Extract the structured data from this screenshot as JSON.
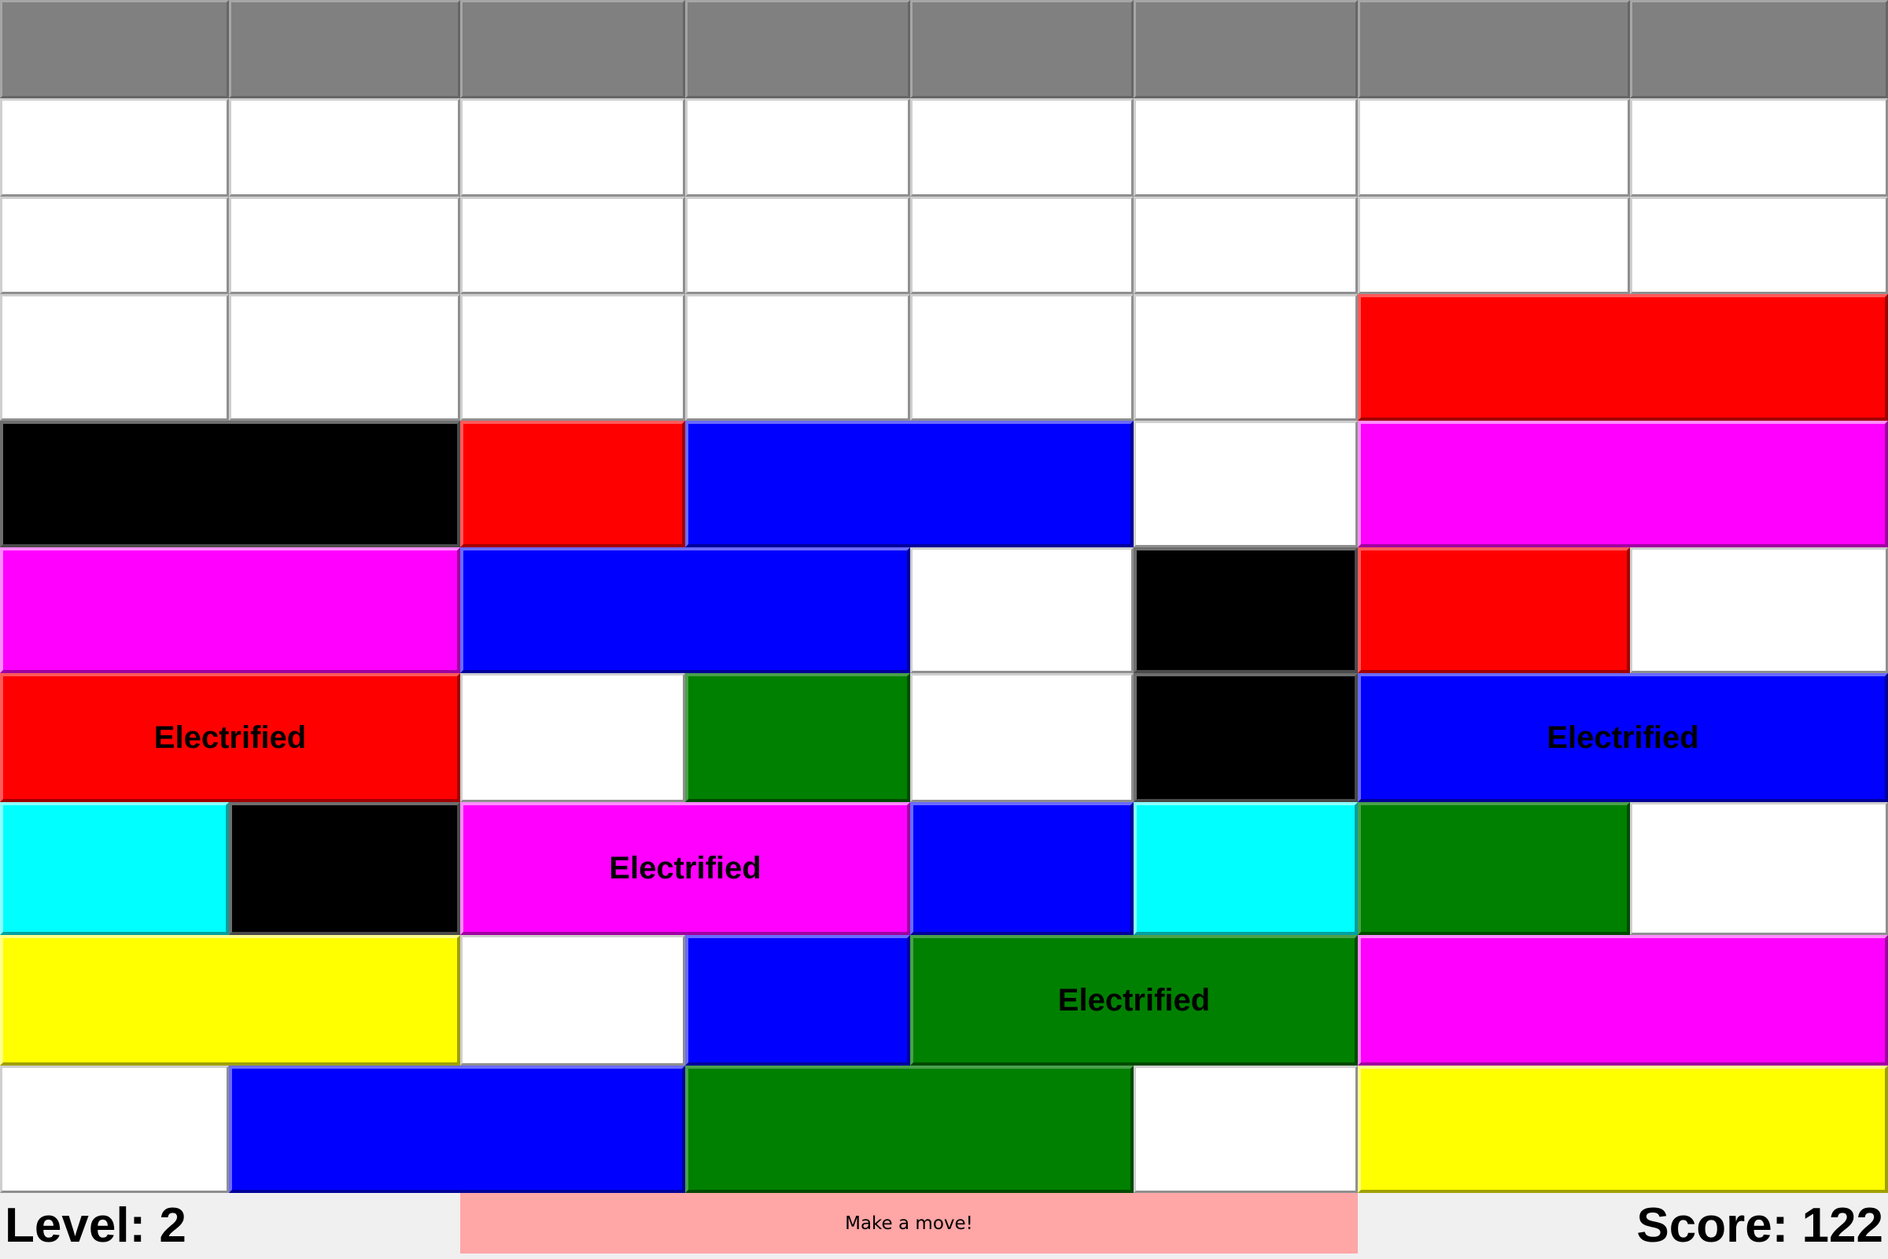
{
  "status": {
    "level": "Level: 2",
    "message": "Make a move!",
    "score": "Score: 122"
  },
  "colors": {
    "red": "#ff0000",
    "blue": "#0000ff",
    "black": "#000000",
    "magenta": "#ff00ff",
    "green": "#008000",
    "cyan": "#00ffff",
    "yellow": "#ffff00",
    "empty": "#ffffff",
    "header": "#808080",
    "message_bg": "#ffa6a6"
  },
  "board": {
    "columns": 8,
    "rows": [
      [
        {
          "type": "header",
          "span": 1
        },
        {
          "type": "header",
          "span": 1
        },
        {
          "type": "header",
          "span": 1
        },
        {
          "type": "header",
          "span": 1
        },
        {
          "type": "header",
          "span": 1
        },
        {
          "type": "header",
          "span": 1
        },
        {
          "type": "header",
          "span": 1
        },
        {
          "type": "header",
          "span": 1
        }
      ],
      [
        {
          "type": "empty",
          "span": 1
        },
        {
          "type": "empty",
          "span": 1
        },
        {
          "type": "empty",
          "span": 1
        },
        {
          "type": "empty",
          "span": 1
        },
        {
          "type": "empty",
          "span": 1
        },
        {
          "type": "empty",
          "span": 1
        },
        {
          "type": "empty",
          "span": 1
        },
        {
          "type": "empty",
          "span": 1
        }
      ],
      [
        {
          "type": "empty",
          "span": 1
        },
        {
          "type": "empty",
          "span": 1
        },
        {
          "type": "empty",
          "span": 1
        },
        {
          "type": "empty",
          "span": 1
        },
        {
          "type": "empty",
          "span": 1
        },
        {
          "type": "empty",
          "span": 1
        },
        {
          "type": "empty",
          "span": 1
        },
        {
          "type": "empty",
          "span": 1
        }
      ],
      [
        {
          "type": "empty",
          "span": 1
        },
        {
          "type": "empty",
          "span": 1
        },
        {
          "type": "empty",
          "span": 1
        },
        {
          "type": "empty",
          "span": 1
        },
        {
          "type": "empty",
          "span": 1
        },
        {
          "type": "empty",
          "span": 1
        },
        {
          "type": "block",
          "color": "red",
          "span": 2
        }
      ],
      [
        {
          "type": "block",
          "color": "black",
          "span": 2
        },
        {
          "type": "block",
          "color": "red",
          "span": 1
        },
        {
          "type": "block",
          "color": "blue",
          "span": 2
        },
        {
          "type": "empty",
          "span": 1
        },
        {
          "type": "block",
          "color": "magenta",
          "span": 2
        }
      ],
      [
        {
          "type": "block",
          "color": "magenta",
          "span": 2
        },
        {
          "type": "block",
          "color": "blue",
          "span": 2
        },
        {
          "type": "empty",
          "span": 1
        },
        {
          "type": "block",
          "color": "black",
          "span": 1
        },
        {
          "type": "block",
          "color": "red",
          "span": 1
        },
        {
          "type": "empty",
          "span": 1
        }
      ],
      [
        {
          "type": "block",
          "color": "red",
          "span": 2,
          "label": "Electrified"
        },
        {
          "type": "empty",
          "span": 1
        },
        {
          "type": "block",
          "color": "green",
          "span": 1
        },
        {
          "type": "empty",
          "span": 1
        },
        {
          "type": "block",
          "color": "black",
          "span": 1
        },
        {
          "type": "block",
          "color": "blue",
          "span": 2,
          "label": "Electrified"
        }
      ],
      [
        {
          "type": "block",
          "color": "cyan",
          "span": 1
        },
        {
          "type": "block",
          "color": "black",
          "span": 1
        },
        {
          "type": "block",
          "color": "magenta",
          "span": 2,
          "label": "Electrified"
        },
        {
          "type": "block",
          "color": "blue",
          "span": 1
        },
        {
          "type": "block",
          "color": "cyan",
          "span": 1
        },
        {
          "type": "block",
          "color": "green",
          "span": 1
        },
        {
          "type": "empty",
          "span": 1
        }
      ],
      [
        {
          "type": "block",
          "color": "yellow",
          "span": 2
        },
        {
          "type": "empty",
          "span": 1
        },
        {
          "type": "block",
          "color": "blue",
          "span": 1
        },
        {
          "type": "block",
          "color": "green",
          "span": 2,
          "label": "Electrified"
        },
        {
          "type": "block",
          "color": "magenta",
          "span": 2
        }
      ],
      [
        {
          "type": "empty",
          "span": 1
        },
        {
          "type": "block",
          "color": "blue",
          "span": 2
        },
        {
          "type": "block",
          "color": "green",
          "span": 2
        },
        {
          "type": "empty",
          "span": 1
        },
        {
          "type": "block",
          "color": "yellow",
          "span": 2
        }
      ]
    ]
  }
}
